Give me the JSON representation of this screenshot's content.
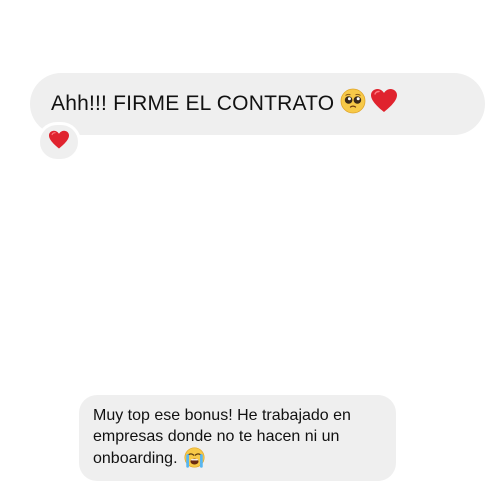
{
  "messages": [
    {
      "text": "Ahh!!! FIRME EL CONTRATO",
      "emojis": [
        "pleading-face-emoji",
        "red-heart-emoji"
      ],
      "reaction": "red-heart-emoji"
    },
    {
      "text": "Muy top ese bonus! He trabajado en empresas donde no te hacen ni un onboarding.",
      "emojis": [
        "loudly-crying-face-emoji"
      ]
    }
  ],
  "colors": {
    "bubble": "#efefef",
    "background": "#ffffff",
    "text": "#111111",
    "heart": "#e0232e"
  }
}
